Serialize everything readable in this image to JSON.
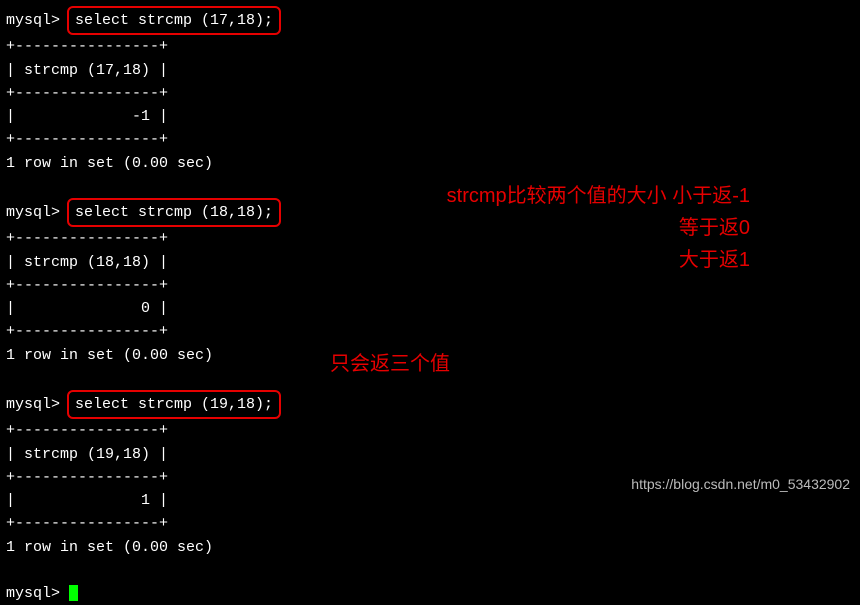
{
  "prompt": "mysql>",
  "queries": [
    {
      "sql": "select strcmp (17,18);",
      "header": "strcmp (17,18)",
      "value": "-1",
      "footer": "1 row in set (0.00 sec)"
    },
    {
      "sql": "select strcmp (18,18);",
      "header": "strcmp (18,18)",
      "value": "0",
      "footer": "1 row in set (0.00 sec)"
    },
    {
      "sql": "select strcmp (19,18);",
      "header": "strcmp (19,18)",
      "value": "1",
      "footer": "1 row in set (0.00 sec)"
    }
  ],
  "divider": "+----------------+",
  "annotations": {
    "line1": "strcmp比较两个值的大小 小于返-1",
    "line2": "等于返0",
    "line3": "大于返1",
    "note2": "只会返三个值"
  },
  "watermark": "https://blog.csdn.net/m0_53432902"
}
